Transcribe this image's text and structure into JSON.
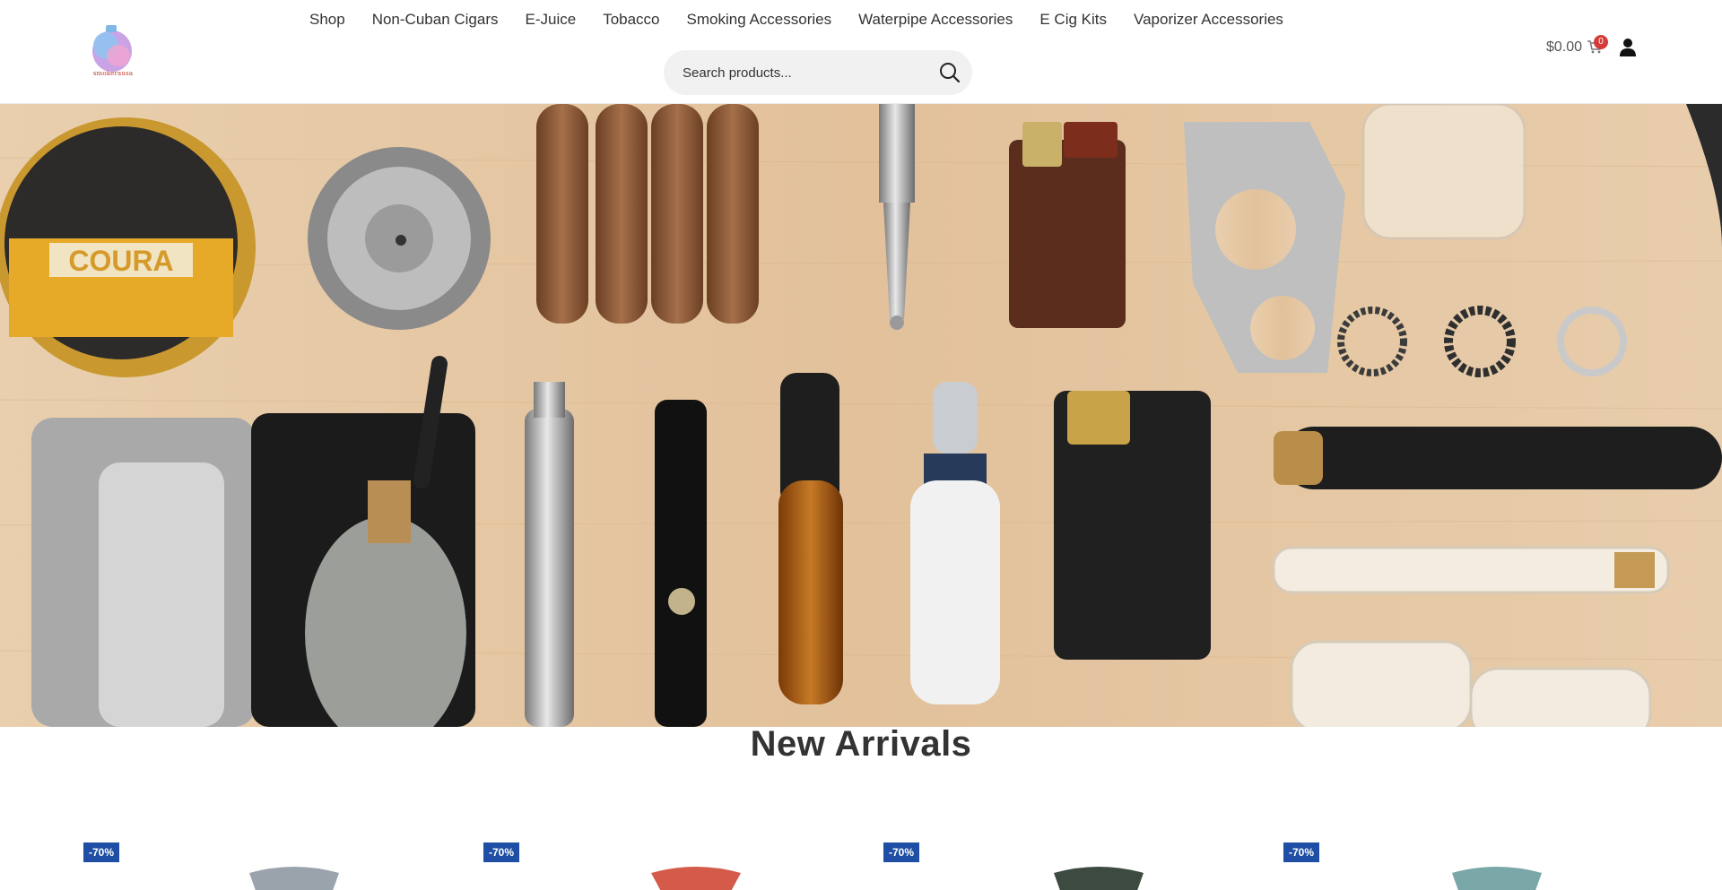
{
  "header": {
    "logo_text": "smokerausa",
    "nav": [
      "Shop",
      "Non-Cuban Cigars",
      "E-Juice",
      "Tobacco",
      "Smoking Accessories",
      "Waterpipe Accessories",
      "E Cig Kits",
      "Vaporizer Accessories"
    ],
    "search": {
      "placeholder": "Search products..."
    },
    "cart": {
      "amount": "$0.00",
      "count": "0"
    }
  },
  "hero": {
    "tin_label": "COURA"
  },
  "new_arrivals": {
    "title": "New Arrivals",
    "products": [
      {
        "badge": "-70%"
      },
      {
        "badge": "-70%"
      },
      {
        "badge": "-70%"
      },
      {
        "badge": "-70%"
      }
    ]
  },
  "colors": {
    "sale_badge": "#1f4fa5",
    "cart_badge": "#d63b3b",
    "search_bg": "#f1f1f1"
  },
  "icons": [
    "search-icon",
    "cart-icon",
    "user-icon"
  ]
}
